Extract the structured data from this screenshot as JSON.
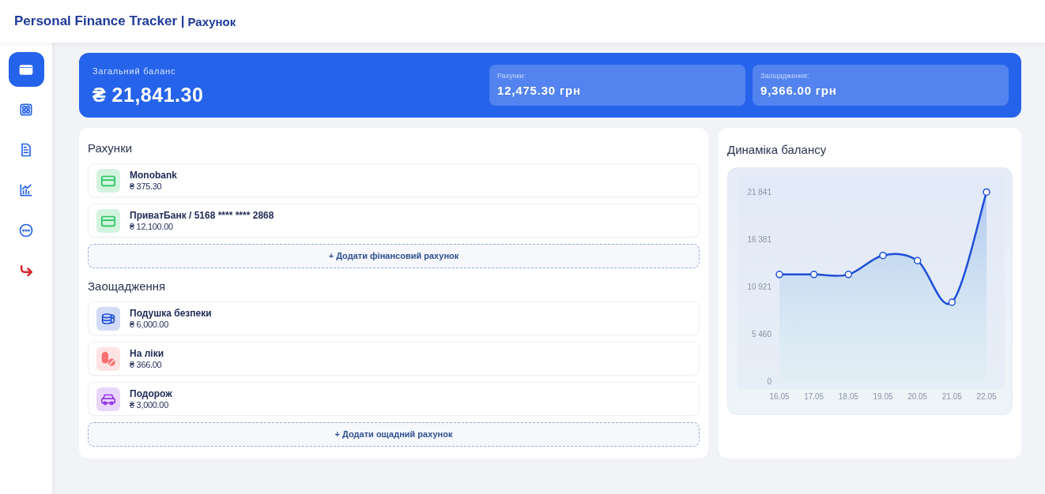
{
  "header": {
    "app_title": "Personal Finance Tracker |",
    "page_title": "Рахунок"
  },
  "sidebar": {
    "items": [
      {
        "kind": "wallet",
        "selected": true
      },
      {
        "kind": "grid",
        "selected": false
      },
      {
        "kind": "document",
        "selected": false
      },
      {
        "kind": "chart",
        "selected": false
      },
      {
        "kind": "more",
        "selected": false
      },
      {
        "kind": "logout",
        "selected": false
      }
    ]
  },
  "balance": {
    "label": "Загальний баланс",
    "value": "₴ 21,841.30",
    "stats": [
      {
        "label": "Рахунки:",
        "value": "12,475.30 грн"
      },
      {
        "label": "Заощадження:",
        "value": "9,366.00 грн"
      }
    ]
  },
  "accounts": {
    "title": "Рахунки",
    "items": [
      {
        "kind": "card",
        "color": "#22c55e",
        "name": "Monobank",
        "amount": "₴ 375.30"
      },
      {
        "kind": "card",
        "color": "#22c55e",
        "name": "ПриватБанк / 5168 **** **** 2868",
        "amount": "₴ 12,100.00"
      }
    ],
    "add_button": "+ Додати фінансовий рахунок"
  },
  "savings": {
    "title": "Заощадження",
    "items": [
      {
        "kind": "coins",
        "color": "#1d4ed8",
        "name": "Подушка безпеки",
        "amount": "₴ 6,000.00"
      },
      {
        "kind": "pills",
        "color": "#f87171",
        "name": "На ліки",
        "amount": "₴ 366.00"
      },
      {
        "kind": "car",
        "color": "#9333ea",
        "name": "Подорож",
        "amount": "₴ 3,000.00"
      }
    ],
    "add_button": "+ Додати ощадний рахунок"
  },
  "balance_chart": {
    "title": "Динаміка балансу",
    "chart_data": {
      "type": "area",
      "categories": [
        "16.05",
        "17.05",
        "18.05",
        "19.05",
        "20.05",
        "21.05",
        "22.05"
      ],
      "series": [
        {
          "color": "#1d4ed8",
          "values": [
            12300,
            12300,
            12300,
            14500,
            13900,
            9100,
            21800
          ]
        }
      ],
      "ylim": [
        0,
        21841
      ],
      "yticks": [
        {
          "value": 0,
          "label": "0"
        },
        {
          "value": 5460,
          "label": "5 460"
        },
        {
          "value": 10921,
          "label": "10 921"
        },
        {
          "value": 16381,
          "label": "16 381"
        },
        {
          "value": 21841,
          "label": "21 841"
        }
      ]
    }
  }
}
